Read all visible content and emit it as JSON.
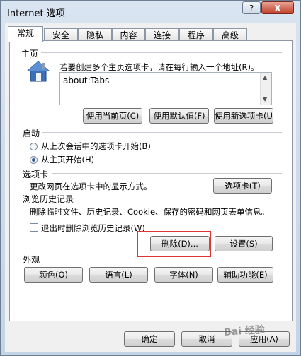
{
  "window": {
    "title": "Internet 选项",
    "help": "?",
    "close": "X"
  },
  "tabs": [
    "常规",
    "安全",
    "隐私",
    "内容",
    "连接",
    "程序",
    "高级"
  ],
  "home": {
    "section": "主页",
    "description": "若要创建多个主页选项卡，请在每行输入一个地址(R)。",
    "url": "about:Tabs",
    "buttons": [
      "使用当前页(C)",
      "使用默认值(F)",
      "使用新选项卡(U)"
    ]
  },
  "startup": {
    "section": "启动",
    "options": [
      "从上次会话中的选项卡开始(B)",
      "从主页开始(H)"
    ],
    "selected_index": 1
  },
  "tabs_section": {
    "section": "选项卡",
    "description": "更改网页在选项卡中的显示方式。",
    "button": "选项卡(T)"
  },
  "history": {
    "section": "浏览历史记录",
    "description": "删除临时文件、历史记录、Cookie、保存的密码和网页表单信息。",
    "checkbox": "退出时删除浏览历史记录(W)",
    "checked": false,
    "delete_button": "删除(D)...",
    "settings_button": "设置(S)"
  },
  "appearance": {
    "section": "外观",
    "buttons": [
      "颜色(O)",
      "语言(L)",
      "字体(N)",
      "辅助功能(E)"
    ]
  },
  "footer": {
    "ok": "确定",
    "cancel": "取消",
    "apply": "应用(A)"
  },
  "watermark": "Bai 经验",
  "colors": {
    "accent": "#2c5aa0",
    "highlight_box": "#dd3333",
    "house_blue": "#3c6fb6"
  }
}
